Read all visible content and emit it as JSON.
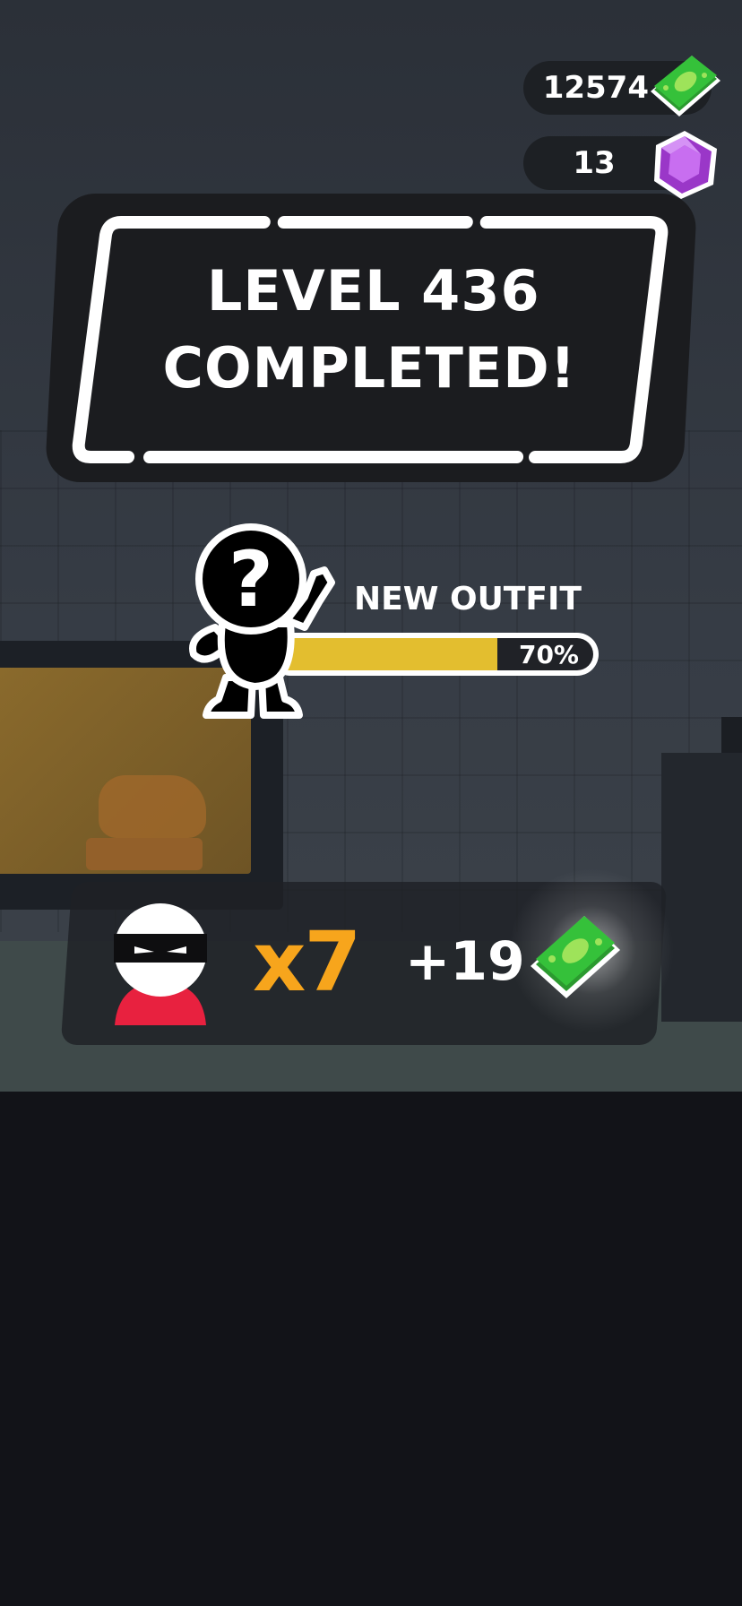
{
  "currency": {
    "cash": "12574",
    "gems": "13"
  },
  "banner": {
    "line1": "LEVEL 436",
    "line2": "COMPLETED!"
  },
  "outfit": {
    "label": "NEW OUTFIT",
    "progress_text": "70%",
    "progress": 0.7
  },
  "reward": {
    "multiplier": "x7",
    "amount": "+19"
  },
  "icons": {
    "cash": "cash-stack-icon",
    "gem": "purple-gem-icon",
    "mystery_outfit": "question-mark-silhouette-icon",
    "thief": "masked-thief-icon"
  },
  "colors": {
    "gold_fill": "#e3be2f",
    "multiplier": "#f7a51c",
    "cash_green": "#35c13a",
    "gem_purple": "#b64fe0"
  }
}
